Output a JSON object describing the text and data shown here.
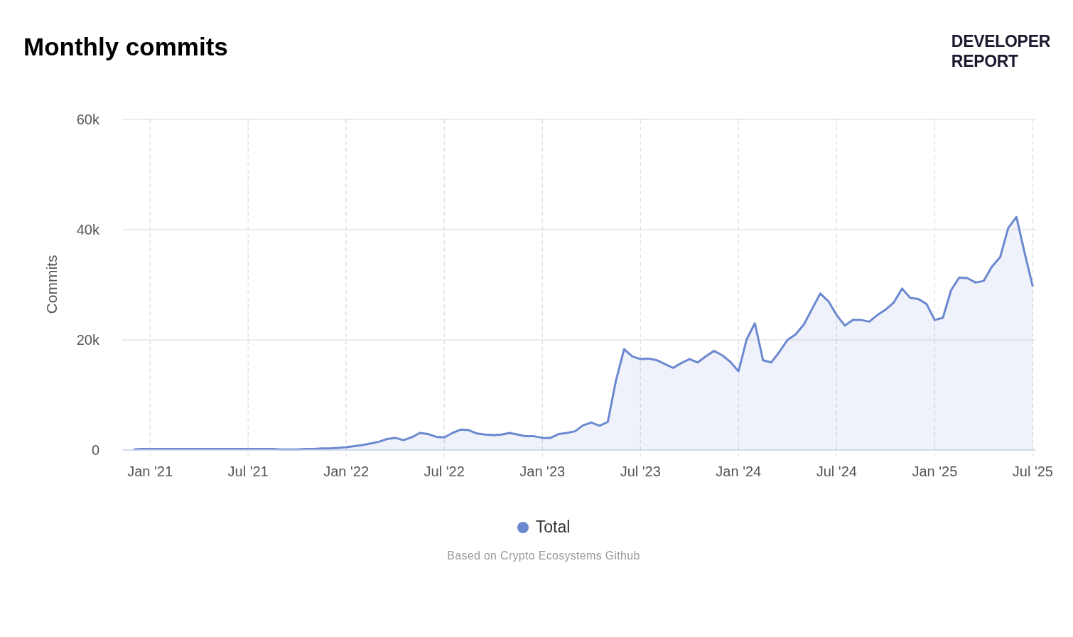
{
  "title": "Monthly commits",
  "logo": {
    "lines": [
      "DEVELOPER",
      "REPORT"
    ]
  },
  "chart": {
    "chart_data": {
      "type": "area",
      "ylabel": "Commits",
      "categories": [
        null,
        null,
        "Jan '21",
        null,
        null,
        null,
        null,
        null,
        null,
        null,
        null,
        null,
        null,
        null,
        "Jul '21",
        null,
        null,
        null,
        null,
        null,
        null,
        null,
        null,
        null,
        null,
        null,
        "Jan '22",
        null,
        null,
        null,
        null,
        null,
        null,
        null,
        null,
        null,
        null,
        null,
        "Jul '22",
        null,
        null,
        null,
        null,
        null,
        null,
        null,
        null,
        null,
        null,
        null,
        "Jan '23",
        null,
        null,
        null,
        null,
        null,
        null,
        null,
        null,
        null,
        null,
        null,
        "Jul '23",
        null,
        null,
        null,
        null,
        null,
        null,
        null,
        null,
        null,
        null,
        null,
        "Jan '24",
        null,
        null,
        null,
        null,
        null,
        null,
        null,
        null,
        null,
        null,
        null,
        "Jul '24",
        null,
        null,
        null,
        null,
        null,
        null,
        null,
        null,
        null,
        null,
        null,
        "Jan '25",
        null,
        null,
        null,
        null,
        null,
        null,
        null,
        null,
        null,
        null,
        null,
        "Jul '25"
      ],
      "series": [
        {
          "name": "Total",
          "color": "#6b88d0",
          "values": [
            100,
            200,
            200,
            200,
            200,
            200,
            200,
            200,
            200,
            200,
            200,
            200,
            200,
            200,
            200,
            200,
            200,
            200,
            100,
            100,
            100,
            200,
            200,
            300,
            300,
            400,
            500,
            700,
            900,
            1200,
            1500,
            2000,
            2200,
            1800,
            2300,
            3100,
            2900,
            2400,
            2300,
            3100,
            3700,
            3600,
            3000,
            2800,
            2700,
            2800,
            3100,
            2800,
            2500,
            2500,
            2200,
            2200,
            2900,
            3100,
            3400,
            4500,
            5000,
            4400,
            5100,
            12600,
            18300,
            17000,
            16500,
            16600,
            16300,
            15600,
            14900,
            15800,
            16500,
            15900,
            17000,
            18000,
            17200,
            16000,
            14300,
            20100,
            23000,
            16300,
            15900,
            17800,
            20000,
            21000,
            22800,
            25600,
            28400,
            27000,
            24500,
            22600,
            23600,
            23600,
            23300,
            24500,
            25500,
            26800,
            29300,
            27600,
            27400,
            26500,
            23600,
            24000,
            29000,
            31300,
            31200,
            30400,
            30700,
            33300,
            35000,
            40300,
            42300,
            35800,
            29700
          ]
        }
      ],
      "ylim": [
        0,
        60000
      ],
      "grid": true,
      "yticks": [
        {
          "value": 0,
          "label": "0"
        },
        {
          "value": 20000,
          "label": "20k"
        },
        {
          "value": 40000,
          "label": "40k"
        },
        {
          "value": 60000,
          "label": "60k"
        }
      ]
    }
  },
  "source": "Based on Crypto Ecosystems Github"
}
